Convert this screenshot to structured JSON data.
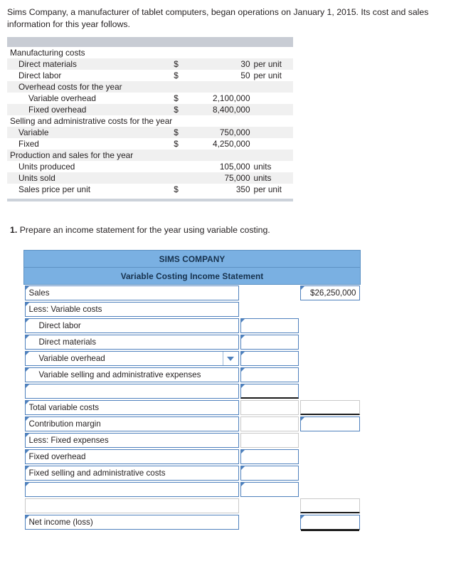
{
  "intro": "Sims Company, a manufacturer of tablet computers, began operations on January 1, 2015. Its cost and sales information for this year follows.",
  "given_data": {
    "rows": [
      {
        "label": "Manufacturing costs",
        "indent": 0,
        "currency": "",
        "amount": "",
        "suffix": "",
        "shaded": false
      },
      {
        "label": "Direct materials",
        "indent": 1,
        "currency": "$",
        "amount": "30",
        "suffix": "per unit",
        "shaded": true
      },
      {
        "label": "Direct labor",
        "indent": 1,
        "currency": "$",
        "amount": "50",
        "suffix": "per unit",
        "shaded": false
      },
      {
        "label": "Overhead costs for the year",
        "indent": 1,
        "currency": "",
        "amount": "",
        "suffix": "",
        "shaded": true
      },
      {
        "label": "Variable overhead",
        "indent": 2,
        "currency": "$",
        "amount": "2,100,000",
        "suffix": "",
        "shaded": false
      },
      {
        "label": "Fixed overhead",
        "indent": 2,
        "currency": "$",
        "amount": "8,400,000",
        "suffix": "",
        "shaded": true
      },
      {
        "label": "Selling and administrative costs for the year",
        "indent": 0,
        "currency": "",
        "amount": "",
        "suffix": "",
        "shaded": false
      },
      {
        "label": "Variable",
        "indent": 1,
        "currency": "$",
        "amount": "750,000",
        "suffix": "",
        "shaded": true
      },
      {
        "label": "Fixed",
        "indent": 1,
        "currency": "$",
        "amount": "4,250,000",
        "suffix": "",
        "shaded": false
      },
      {
        "label": "Production and sales for the year",
        "indent": 0,
        "currency": "",
        "amount": "",
        "suffix": "",
        "shaded": true
      },
      {
        "label": "Units produced",
        "indent": 1,
        "currency": "",
        "amount": "105,000",
        "suffix": "units",
        "shaded": false
      },
      {
        "label": "Units sold",
        "indent": 1,
        "currency": "",
        "amount": "75,000",
        "suffix": "units",
        "shaded": true
      },
      {
        "label": "Sales price per unit",
        "indent": 1,
        "currency": "$",
        "amount": "350",
        "suffix": "per unit",
        "shaded": false
      }
    ]
  },
  "requirement": {
    "number": "1.",
    "text": "Prepare an income statement for the year using variable costing."
  },
  "worksheet": {
    "company_title": "SIMS COMPANY",
    "statement_title": "Variable Costing Income Statement",
    "rows": [
      {
        "kind": "input",
        "label": "Sales",
        "indent": 0,
        "dropdown": false,
        "mid": "none",
        "right": "input",
        "right_value": "$26,250,000",
        "mid_value": "",
        "rule": ""
      },
      {
        "kind": "input",
        "label": "Less: Variable costs",
        "indent": 0,
        "dropdown": false,
        "mid": "none",
        "right": "none",
        "right_value": "",
        "mid_value": "",
        "rule": ""
      },
      {
        "kind": "input",
        "label": "Direct labor",
        "indent": 1,
        "dropdown": false,
        "mid": "input",
        "right": "none",
        "right_value": "",
        "mid_value": "",
        "rule": ""
      },
      {
        "kind": "input",
        "label": "Direct materials",
        "indent": 1,
        "dropdown": false,
        "mid": "input",
        "right": "none",
        "right_value": "",
        "mid_value": "",
        "rule": ""
      },
      {
        "kind": "input",
        "label": "Variable overhead",
        "indent": 1,
        "dropdown": true,
        "mid": "input",
        "right": "none",
        "right_value": "",
        "mid_value": "",
        "rule": ""
      },
      {
        "kind": "input",
        "label": "Variable selling and administrative expenses",
        "indent": 1,
        "dropdown": false,
        "mid": "input",
        "right": "none",
        "right_value": "",
        "mid_value": "",
        "rule": ""
      },
      {
        "kind": "input",
        "label": "",
        "indent": 1,
        "dropdown": false,
        "mid": "input",
        "right": "none",
        "right_value": "",
        "mid_value": "",
        "rule": "mid"
      },
      {
        "kind": "input",
        "label": "Total variable costs",
        "indent": 0,
        "dropdown": false,
        "mid": "box",
        "right": "box",
        "right_value": "",
        "mid_value": "",
        "rule": "right"
      },
      {
        "kind": "input",
        "label": "Contribution margin",
        "indent": 0,
        "dropdown": false,
        "mid": "box",
        "right": "input",
        "right_value": "",
        "mid_value": "",
        "rule": ""
      },
      {
        "kind": "input",
        "label": "Less: Fixed expenses",
        "indent": 0,
        "dropdown": false,
        "mid": "box",
        "right": "none",
        "right_value": "",
        "mid_value": "",
        "rule": ""
      },
      {
        "kind": "input",
        "label": "Fixed overhead",
        "indent": 0,
        "dropdown": false,
        "mid": "input",
        "right": "none",
        "right_value": "",
        "mid_value": "",
        "rule": ""
      },
      {
        "kind": "input",
        "label": "Fixed selling and administrative costs",
        "indent": 0,
        "dropdown": false,
        "mid": "input",
        "right": "none",
        "right_value": "",
        "mid_value": "",
        "rule": ""
      },
      {
        "kind": "input",
        "label": "",
        "indent": 0,
        "dropdown": false,
        "mid": "input",
        "right": "none",
        "right_value": "",
        "mid_value": "",
        "rule": ""
      },
      {
        "kind": "spacer",
        "label": "",
        "indent": 0,
        "dropdown": false,
        "mid": "none",
        "right": "box",
        "right_value": "",
        "mid_value": "",
        "rule": "rightbot"
      },
      {
        "kind": "input",
        "label": "Net income (loss)",
        "indent": 0,
        "dropdown": false,
        "mid": "none",
        "right": "input",
        "right_value": "",
        "mid_value": "",
        "rule": "double"
      }
    ]
  }
}
